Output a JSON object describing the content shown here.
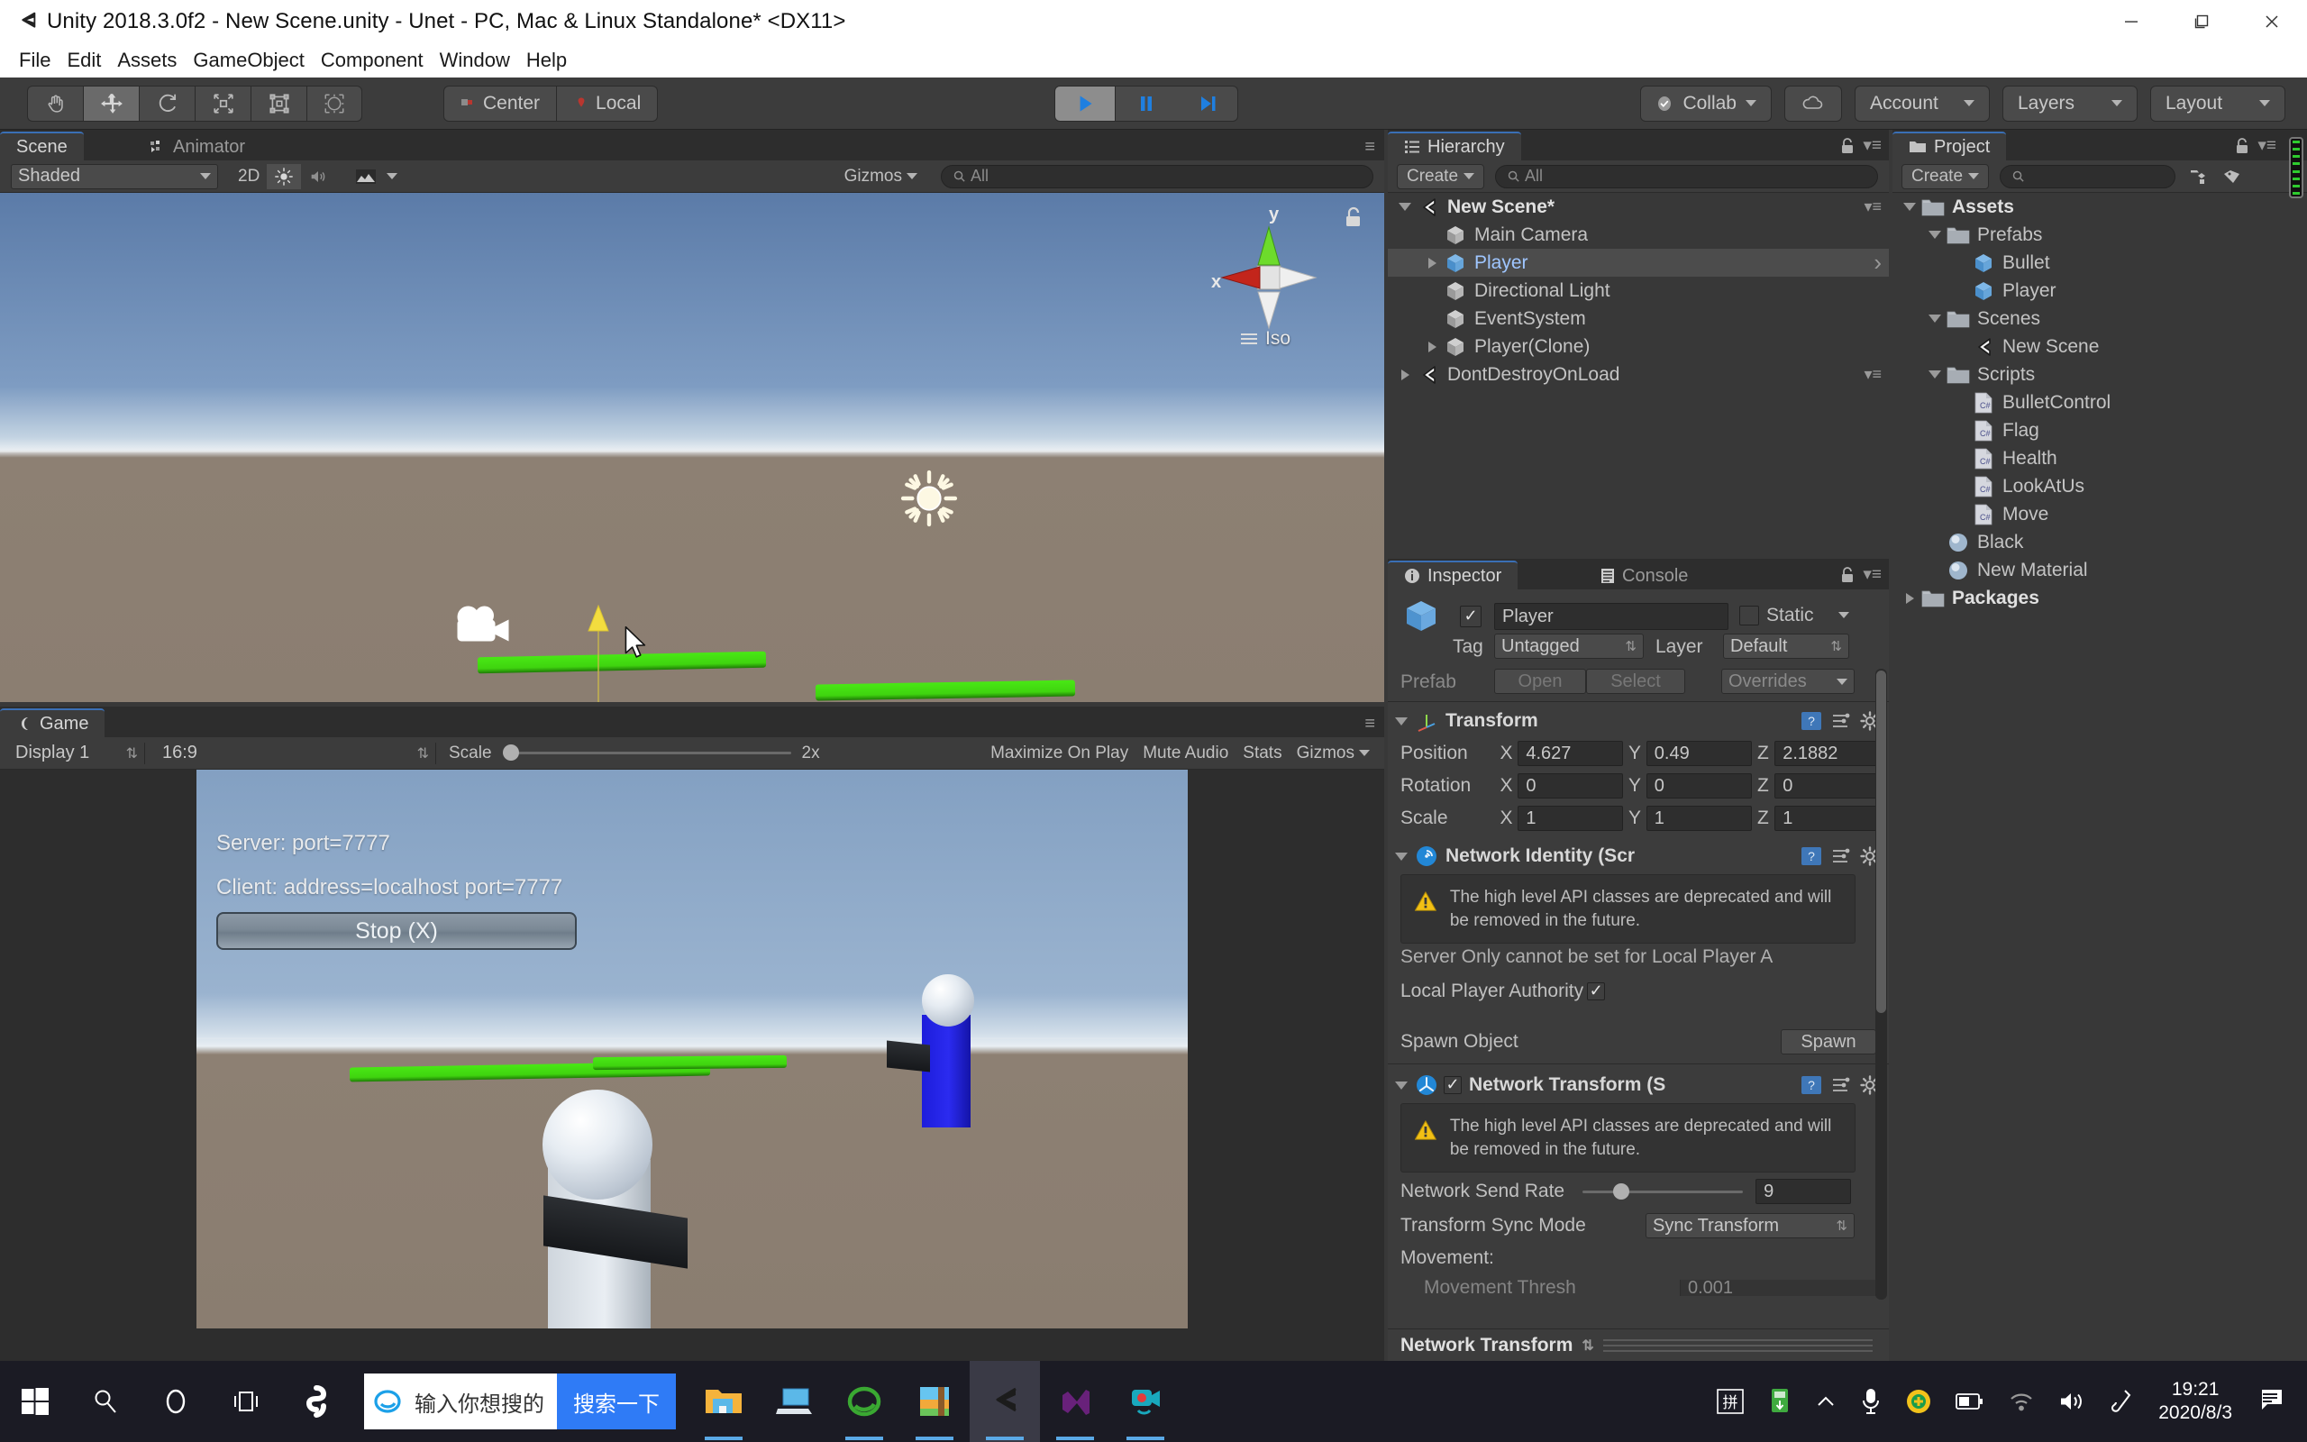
{
  "window": {
    "title": "Unity 2018.3.0f2 - New Scene.unity - Unet - PC, Mac & Linux Standalone* <DX11>",
    "minimize_label": "Minimize",
    "maximize_label": "Restore",
    "close_label": "Close"
  },
  "menubar": {
    "items": [
      "File",
      "Edit",
      "Assets",
      "GameObject",
      "Component",
      "Window",
      "Help"
    ]
  },
  "toolbar": {
    "tools": [
      {
        "name": "hand-tool",
        "active": false
      },
      {
        "name": "move-tool",
        "active": true
      },
      {
        "name": "rotate-tool",
        "active": false
      },
      {
        "name": "scale-tool",
        "active": false
      },
      {
        "name": "rect-tool",
        "active": false
      },
      {
        "name": "transform-tool",
        "active": false
      }
    ],
    "pivot_mode": "Center",
    "pivot_rotation": "Local",
    "play": "Play",
    "pause": "Pause",
    "step": "Step",
    "collab": "Collab",
    "cloud": "Cloud",
    "account": "Account",
    "layers": "Layers",
    "layout": "Layout"
  },
  "scene_panel": {
    "tabs": [
      {
        "label": "Scene",
        "active": true
      },
      {
        "label": "Animator",
        "active": false
      }
    ],
    "draw_mode": "Shaded",
    "two_d": "2D",
    "gizmos": "Gizmos",
    "search_placeholder": "All",
    "gizmo": {
      "x_label": "x",
      "y_label": "y",
      "projection": "Iso"
    }
  },
  "game_panel": {
    "tab": "Game",
    "display": "Display 1",
    "aspect": "16:9",
    "scale_label": "Scale",
    "scale_value": "2x",
    "maximize_on_play": "Maximize On Play",
    "mute_audio": "Mute Audio",
    "stats": "Stats",
    "gizmos": "Gizmos",
    "overlay": {
      "server": "Server: port=7777",
      "client": "Client: address=localhost port=7777",
      "stop_button": "Stop (X)"
    }
  },
  "hierarchy": {
    "tab": "Hierarchy",
    "create": "Create",
    "search_placeholder": "All",
    "items": [
      {
        "label": "New Scene*",
        "depth": 0,
        "icon": "unity-scene-icon",
        "expanded": true,
        "selected": false,
        "bold": true,
        "menu": true
      },
      {
        "label": "Main Camera",
        "depth": 1,
        "icon": "gameobject-cube-icon",
        "expanded": null,
        "selected": false,
        "bold": false,
        "menu": false
      },
      {
        "label": "Player",
        "depth": 1,
        "icon": "prefab-cube-icon",
        "expanded": false,
        "selected": true,
        "bold": false,
        "menu": false,
        "chevron": true
      },
      {
        "label": "Directional Light",
        "depth": 1,
        "icon": "gameobject-cube-icon",
        "expanded": null,
        "selected": false,
        "bold": false,
        "menu": false
      },
      {
        "label": "EventSystem",
        "depth": 1,
        "icon": "gameobject-cube-icon",
        "expanded": null,
        "selected": false,
        "bold": false,
        "menu": false
      },
      {
        "label": "Player(Clone)",
        "depth": 1,
        "icon": "gameobject-cube-icon",
        "expanded": false,
        "selected": false,
        "bold": false,
        "menu": false
      },
      {
        "label": "DontDestroyOnLoad",
        "depth": 0,
        "icon": "unity-scene-icon",
        "expanded": false,
        "selected": false,
        "bold": false,
        "menu": true
      }
    ]
  },
  "project": {
    "tab": "Project",
    "create": "Create",
    "search_placeholder": "",
    "items": [
      {
        "label": "Assets",
        "depth": 0,
        "icon": "folder-icon",
        "expanded": true,
        "bold": true
      },
      {
        "label": "Prefabs",
        "depth": 1,
        "icon": "folder-icon",
        "expanded": true,
        "bold": false
      },
      {
        "label": "Bullet",
        "depth": 2,
        "icon": "prefab-cube-icon",
        "expanded": null,
        "bold": false
      },
      {
        "label": "Player",
        "depth": 2,
        "icon": "prefab-cube-icon",
        "expanded": null,
        "bold": false
      },
      {
        "label": "Scenes",
        "depth": 1,
        "icon": "folder-icon",
        "expanded": true,
        "bold": false
      },
      {
        "label": "New Scene",
        "depth": 2,
        "icon": "unity-scene-icon",
        "expanded": null,
        "bold": false
      },
      {
        "label": "Scripts",
        "depth": 1,
        "icon": "folder-icon",
        "expanded": true,
        "bold": false
      },
      {
        "label": "BulletControl",
        "depth": 2,
        "icon": "csharp-script-icon",
        "expanded": null,
        "bold": false
      },
      {
        "label": "Flag",
        "depth": 2,
        "icon": "csharp-script-icon",
        "expanded": null,
        "bold": false
      },
      {
        "label": "Health",
        "depth": 2,
        "icon": "csharp-script-icon",
        "expanded": null,
        "bold": false
      },
      {
        "label": "LookAtUs",
        "depth": 2,
        "icon": "csharp-script-icon",
        "expanded": null,
        "bold": false
      },
      {
        "label": "Move",
        "depth": 2,
        "icon": "csharp-script-icon",
        "expanded": null,
        "bold": false
      },
      {
        "label": "Black",
        "depth": 1,
        "icon": "material-sphere-icon",
        "expanded": null,
        "bold": false
      },
      {
        "label": "New Material",
        "depth": 1,
        "icon": "material-sphere-icon",
        "expanded": null,
        "bold": false
      },
      {
        "label": "Packages",
        "depth": 0,
        "icon": "folder-icon",
        "expanded": false,
        "bold": true
      }
    ]
  },
  "inspector": {
    "tabs": [
      {
        "label": "Inspector",
        "active": true
      },
      {
        "label": "Console",
        "active": false
      }
    ],
    "object_name": "Player",
    "enabled": true,
    "static_label": "Static",
    "tag_label": "Tag",
    "tag_value": "Untagged",
    "layer_label": "Layer",
    "layer_value": "Default",
    "prefab_label": "Prefab",
    "prefab_open": "Open",
    "prefab_select": "Select",
    "prefab_overrides": "Overrides",
    "transform": {
      "title": "Transform",
      "rows": [
        {
          "label": "Position",
          "x": "4.627",
          "y": "0.49",
          "z": "2.1882"
        },
        {
          "label": "Rotation",
          "x": "0",
          "y": "0",
          "z": "0"
        },
        {
          "label": "Scale",
          "x": "1",
          "y": "1",
          "z": "1"
        }
      ],
      "axis_labels": [
        "X",
        "Y",
        "Z"
      ]
    },
    "network_identity": {
      "title": "Network Identity (Scr",
      "warning": "The high level API classes are deprecated and will be removed in the future.",
      "server_only_note": "Server Only cannot be set for Local Player A",
      "local_player_authority_label": "Local Player Authority",
      "local_player_authority": true,
      "spawn_object_label": "Spawn Object",
      "spawn_button": "Spawn"
    },
    "network_transform": {
      "title": "Network Transform (S",
      "enabled": true,
      "warning": "The high level API classes are deprecated and will be removed in the future.",
      "send_rate_label": "Network Send Rate",
      "send_rate_value": "9",
      "sync_mode_label": "Transform Sync Mode",
      "sync_mode_value": "Sync Transform",
      "movement_label": "Movement:",
      "movement_threshold_label": "Movement Thresh",
      "movement_threshold_value": "0.001"
    },
    "footer_title": "Network Transform"
  },
  "taskbar": {
    "start": "Start",
    "search_icon": "search-icon",
    "cortana_icon": "cortana-icon",
    "taskview_icon": "task-view-icon",
    "sogou_icon": "sogou-icon",
    "search_placeholder": "输入你想搜的",
    "search_button": "搜索一下",
    "apps": [
      {
        "name": "file-explorer-icon",
        "active": false,
        "running": true
      },
      {
        "name": "remote-desktop-icon",
        "active": false,
        "running": false
      },
      {
        "name": "ie-browser-icon",
        "active": false,
        "running": true
      },
      {
        "name": "winrar-icon",
        "active": false,
        "running": true
      },
      {
        "name": "unity-editor-icon",
        "active": true,
        "running": true
      },
      {
        "name": "visual-studio-icon",
        "active": false,
        "running": true
      },
      {
        "name": "screen-recorder-icon",
        "active": false,
        "running": true
      }
    ],
    "tray": [
      {
        "name": "ime-pinyin-icon"
      },
      {
        "name": "usb-device-icon"
      },
      {
        "name": "show-hidden-icons-icon"
      },
      {
        "name": "microphone-icon"
      },
      {
        "name": "antivirus-icon"
      },
      {
        "name": "battery-icon"
      },
      {
        "name": "wifi-icon"
      },
      {
        "name": "volume-icon"
      },
      {
        "name": "pen-icon"
      }
    ],
    "time": "19:21",
    "date": "2020/8/3",
    "action_center": "action-center-icon"
  }
}
